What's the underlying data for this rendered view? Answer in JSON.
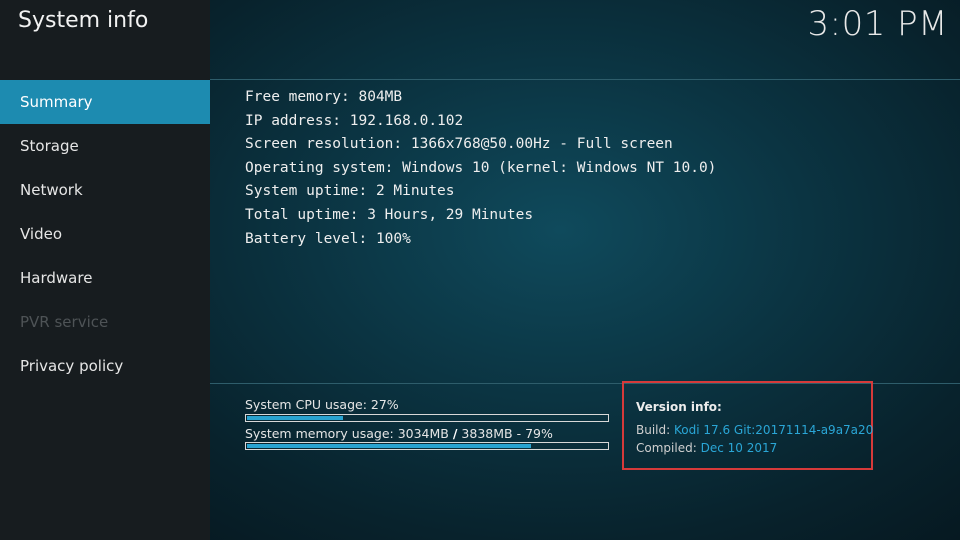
{
  "header": {
    "title": "System info",
    "clock": "3:01 PM"
  },
  "sidebar": {
    "items": [
      {
        "label": "Summary",
        "state": "active"
      },
      {
        "label": "Storage",
        "state": "normal"
      },
      {
        "label": "Network",
        "state": "normal"
      },
      {
        "label": "Video",
        "state": "normal"
      },
      {
        "label": "Hardware",
        "state": "normal"
      },
      {
        "label": "PVR service",
        "state": "disabled"
      },
      {
        "label": "Privacy policy",
        "state": "normal"
      }
    ]
  },
  "summary": {
    "lines": [
      "Free memory: 804MB",
      "IP address: 192.168.0.102",
      "Screen resolution: 1366x768@50.00Hz - Full screen",
      "Operating system: Windows 10 (kernel: Windows NT 10.0)",
      "System uptime: 2 Minutes",
      "Total uptime: 3 Hours, 29 Minutes",
      "Battery level: 100%"
    ]
  },
  "usage": {
    "cpu": {
      "label": "System CPU usage: 27%",
      "percent": 27
    },
    "memory": {
      "label_used": "System memory usage: 3034MB",
      "slash": "/",
      "label_total": "3838MB",
      "dash": "-",
      "label_percent": "79%",
      "percent": 79
    }
  },
  "version_info": {
    "title": "Version info:",
    "build_label": "Build:",
    "build_value": "Kodi 17.6 Git:20171114-a9a7a20",
    "compiled_label": "Compiled:",
    "compiled_value": "Dec 10 2017"
  },
  "colors": {
    "accent": "#1d8bb0",
    "highlight_box": "#d63a3a",
    "link_text": "#2aa6d6"
  }
}
